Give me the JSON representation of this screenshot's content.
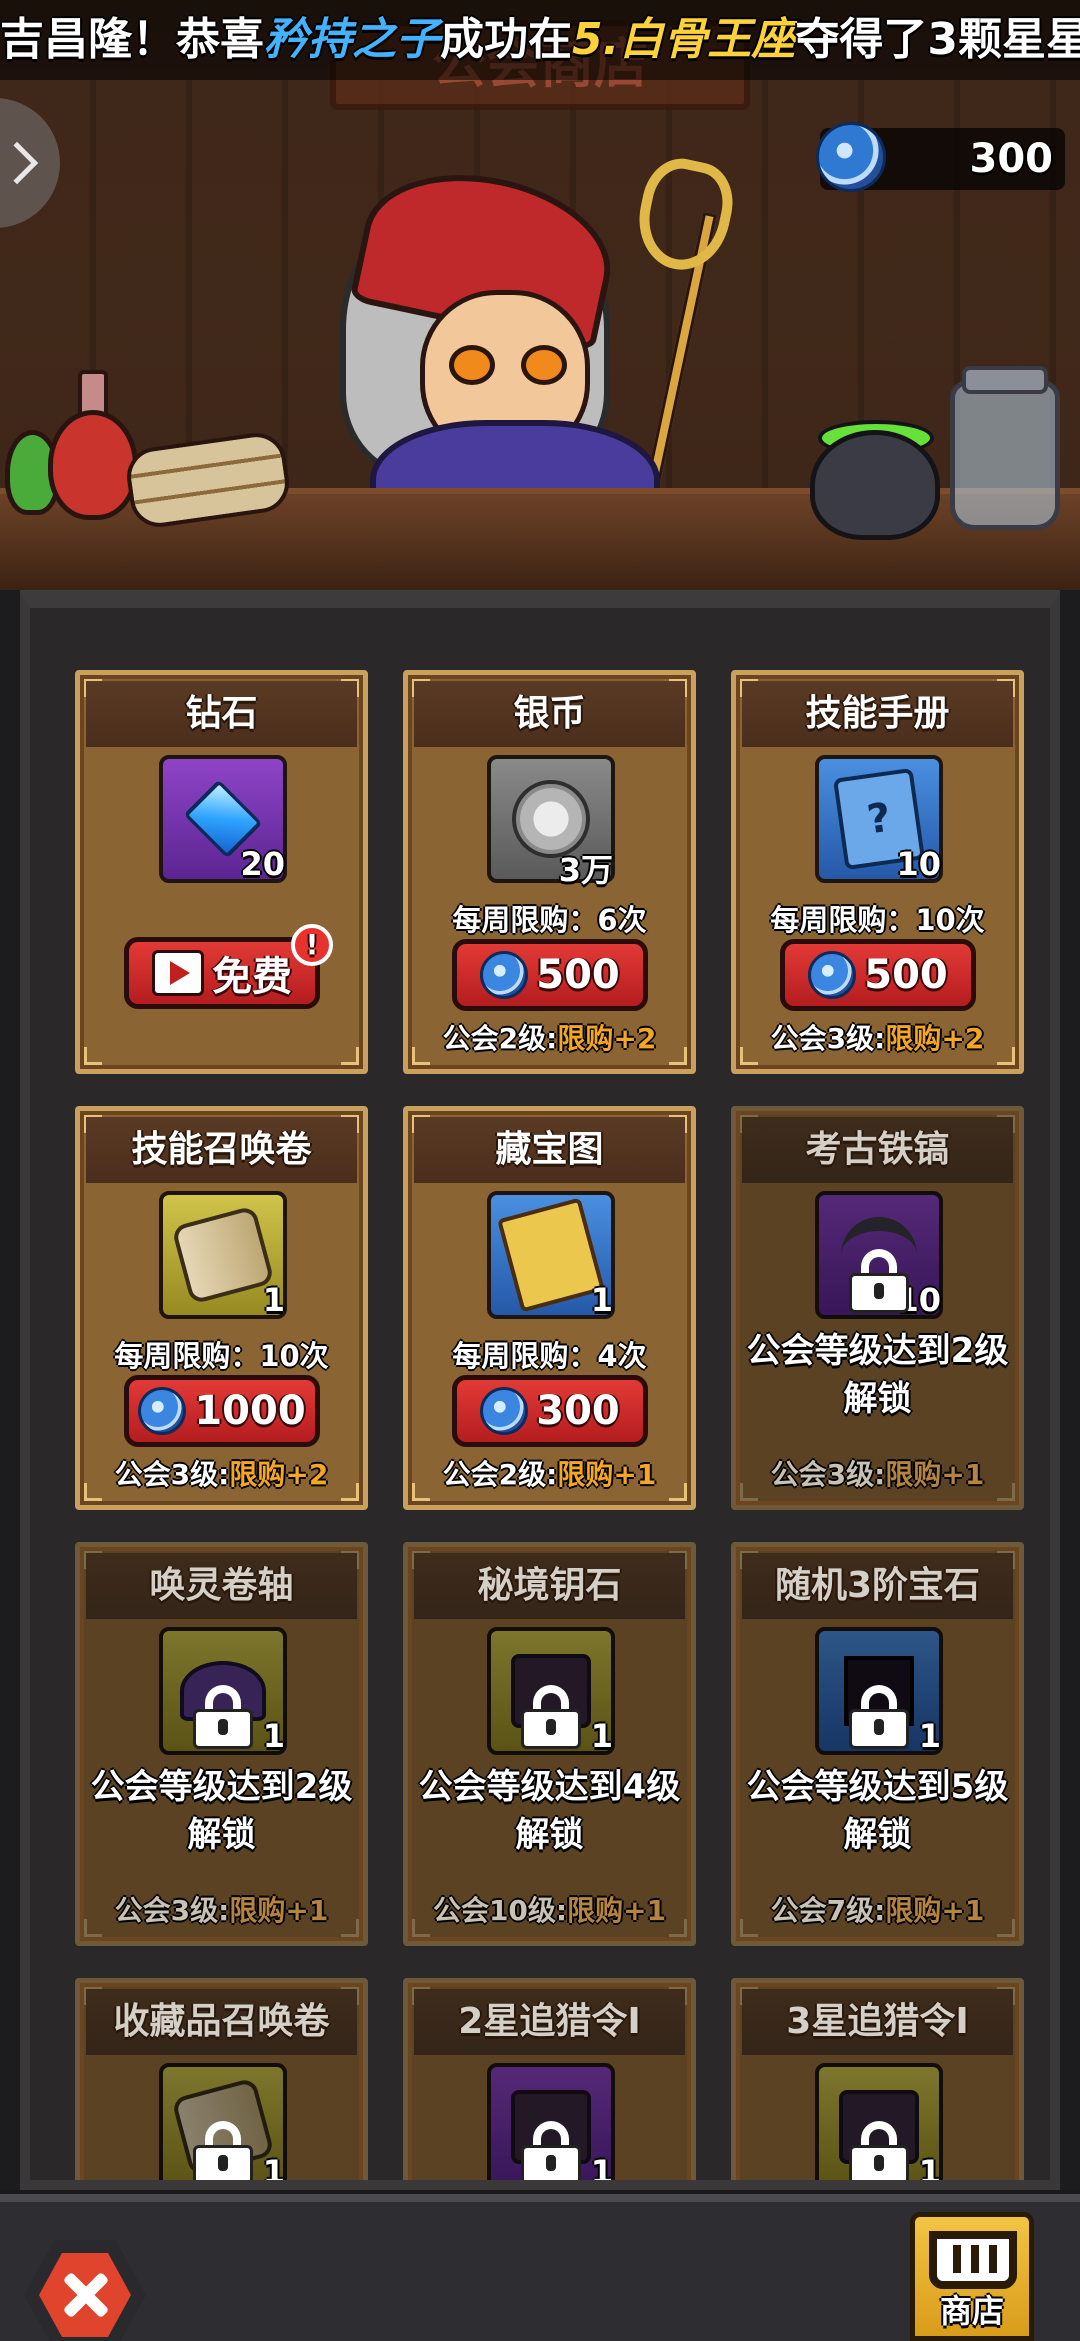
{
  "banner": {
    "marquee": {
      "prefix": "吉昌隆！恭喜",
      "player": "矜持之子",
      "middle": "成功在",
      "stage": "5.白骨王座",
      "suffix": "夺得了3颗星星！"
    },
    "sign_text": "公会商店",
    "currency": {
      "icon": "guild-coin-icon",
      "amount": "300"
    }
  },
  "items": [
    {
      "name": "钻石",
      "icon": "diamond-icon",
      "color": "purple",
      "count": "20",
      "locked": false,
      "limit": "",
      "button": {
        "type": "free",
        "label": "免费",
        "badge": "!"
      },
      "guild_level": "",
      "bonus": ""
    },
    {
      "name": "银币",
      "icon": "silver-coin-icon",
      "color": "gray",
      "count": "3万",
      "locked": false,
      "limit": "每周限购：6次",
      "button": {
        "type": "price",
        "label": "500"
      },
      "guild_level": "公会2级:",
      "bonus": "限购+2"
    },
    {
      "name": "技能手册",
      "icon": "skill-manual-icon",
      "color": "blue",
      "count": "10",
      "locked": false,
      "limit": "每周限购：10次",
      "button": {
        "type": "price",
        "label": "500"
      },
      "guild_level": "公会3级:",
      "bonus": "限购+2"
    },
    {
      "name": "技能召唤卷",
      "icon": "skill-summon-scroll-icon",
      "color": "yellow",
      "count": "1",
      "locked": false,
      "limit": "每周限购：10次",
      "button": {
        "type": "price",
        "label": "1000"
      },
      "guild_level": "公会3级:",
      "bonus": "限购+2"
    },
    {
      "name": "藏宝图",
      "icon": "treasure-map-icon",
      "color": "blue",
      "count": "1",
      "locked": false,
      "limit": "每周限购：4次",
      "button": {
        "type": "price",
        "label": "300"
      },
      "guild_level": "公会2级:",
      "bonus": "限购+1"
    },
    {
      "name": "考古铁镐",
      "icon": "pickaxe-icon",
      "color": "purple",
      "count": "10",
      "locked": true,
      "unlock": [
        "公会等级达到2级",
        "解锁"
      ],
      "guild_level": "公会3级:",
      "bonus": "限购+1"
    },
    {
      "name": "唤灵卷轴",
      "icon": "spirit-scroll-icon",
      "color": "yellow",
      "count": "1",
      "locked": true,
      "unlock": [
        "公会等级达到2级",
        "解锁"
      ],
      "guild_level": "公会3级:",
      "bonus": "限购+1"
    },
    {
      "name": "秘境钥石",
      "icon": "key-stone-icon",
      "color": "yellow",
      "count": "1",
      "locked": true,
      "unlock": [
        "公会等级达到4级",
        "解锁"
      ],
      "guild_level": "公会10级:",
      "bonus": "限购+1"
    },
    {
      "name": "随机3阶宝石",
      "icon": "random-gem-icon",
      "color": "blue",
      "count": "1",
      "locked": true,
      "unlock": [
        "公会等级达到5级",
        "解锁"
      ],
      "guild_level": "公会7级:",
      "bonus": "限购+1"
    },
    {
      "name": "收藏品召唤卷",
      "icon": "collectible-scroll-icon",
      "color": "yellow",
      "count": "1",
      "locked": true,
      "unlock": [],
      "guild_level": "",
      "bonus": ""
    },
    {
      "name": "2星追猎令I",
      "icon": "hunt-order-icon",
      "color": "purple",
      "count": "1",
      "locked": true,
      "unlock": [],
      "guild_level": "",
      "bonus": ""
    },
    {
      "name": "3星追猎令I",
      "icon": "hunt-order-icon",
      "color": "yellow",
      "count": "1",
      "locked": true,
      "unlock": [],
      "guild_level": "",
      "bonus": ""
    }
  ],
  "bottom": {
    "close_icon": "close-icon",
    "shop_label": "商店",
    "shop_icon": "cart-icon"
  }
}
